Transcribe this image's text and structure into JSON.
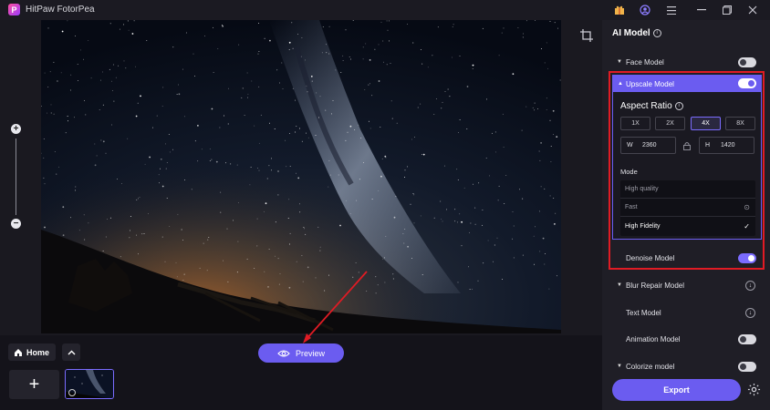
{
  "app": {
    "title": "HitPaw FotorPea",
    "logo_letter": "P"
  },
  "titlebar": {
    "icons": [
      "gift-icon",
      "account-icon",
      "menu-icon",
      "minimize-icon",
      "maximize-icon",
      "close-icon"
    ]
  },
  "canvas": {
    "zoom_plus": "+",
    "zoom_minus": "−"
  },
  "bottom": {
    "home_label": "Home",
    "preview_label": "Preview",
    "add_label": "+"
  },
  "panel": {
    "title": "AI Model",
    "face_model": {
      "label": "Face Model",
      "enabled": false
    },
    "upscale_model": {
      "label": "Upscale Model",
      "enabled": true,
      "aspect_title": "Aspect Ratio",
      "ratios": [
        "1X",
        "2X",
        "4X",
        "8X"
      ],
      "selected_ratio": "4X",
      "width_key": "W",
      "width_value": "2360",
      "height_key": "H",
      "height_value": "1420",
      "mode_label": "Mode",
      "modes": [
        "High quality",
        "Fast",
        "High Fidelity"
      ],
      "selected_mode": "High Fidelity"
    },
    "denoise_model": {
      "label": "Denoise Model",
      "enabled": true
    },
    "blur_repair_model": {
      "label": "Blur Repair Model"
    },
    "text_model": {
      "label": "Text Model"
    },
    "animation_model": {
      "label": "Animation Model",
      "enabled": false
    },
    "colorize_model": {
      "label": "Colorize model",
      "enabled": false
    },
    "export_label": "Export"
  },
  "colors": {
    "accent": "#6b5cf0",
    "highlight": "#e01b24",
    "annotation_arrow": "#e01b24"
  }
}
